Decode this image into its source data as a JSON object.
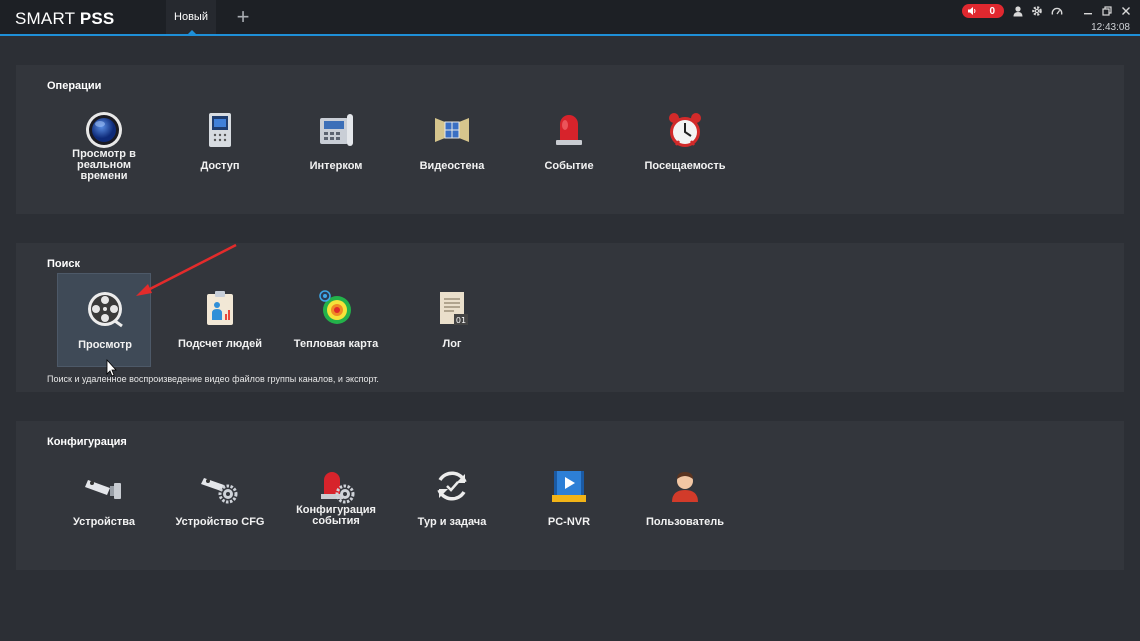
{
  "app": {
    "brand_light": "SMART",
    "brand_bold": "PSS"
  },
  "tabs": [
    {
      "label": "Новый"
    }
  ],
  "toolbar": {
    "add_tab_label": "+",
    "alarm_count": "0",
    "time": "12:43:08"
  },
  "icons": {
    "alarm": "speaker-icon",
    "user": "user-icon",
    "settings": "gear-icon",
    "performance": "gauge-icon",
    "minimize": "minimize-icon",
    "restore": "restore-icon",
    "close": "close-icon"
  },
  "colors": {
    "accent": "#1e8fd8",
    "alarm": "#e0282f",
    "panel": "#33363c",
    "background": "#2c2f35"
  },
  "sections": {
    "operations": {
      "title": "Операции",
      "items": [
        {
          "label": "Просмотр в реальном времени",
          "icon": "live-view-icon"
        },
        {
          "label": "Доступ",
          "icon": "access-control-icon"
        },
        {
          "label": "Интерком",
          "icon": "intercom-icon"
        },
        {
          "label": "Видеостена",
          "icon": "video-wall-icon"
        },
        {
          "label": "Событие",
          "icon": "event-siren-icon"
        },
        {
          "label": "Посещаемость",
          "icon": "alarm-clock-icon"
        }
      ]
    },
    "search": {
      "title": "Поиск",
      "items": [
        {
          "label": "Просмотр",
          "icon": "playback-reel-icon",
          "selected": true
        },
        {
          "label": "Подсчет людей",
          "icon": "people-counting-icon"
        },
        {
          "label": "Тепловая карта",
          "icon": "heat-map-icon"
        },
        {
          "label": "Лог",
          "icon": "log-icon"
        }
      ],
      "hint": "Поиск и удаленное воспроизведение видео файлов группы каналов, и экспорт."
    },
    "config": {
      "title": "Конфигурация",
      "items": [
        {
          "label": "Устройства",
          "icon": "camera-device-icon"
        },
        {
          "label": "Устройство CFG",
          "icon": "camera-config-icon"
        },
        {
          "label": "Конфигурация события",
          "icon": "event-config-icon"
        },
        {
          "label": "Тур и задача",
          "icon": "tour-task-icon"
        },
        {
          "label": "PC-NVR",
          "icon": "pc-nvr-icon"
        },
        {
          "label": "Пользователь",
          "icon": "user-account-icon"
        }
      ]
    }
  }
}
